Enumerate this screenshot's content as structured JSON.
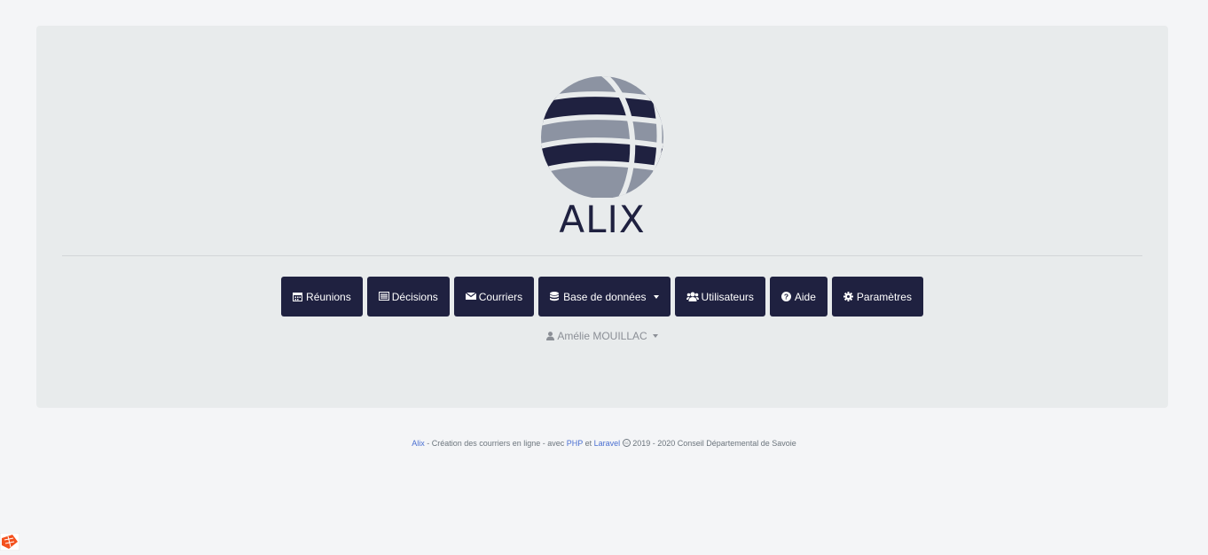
{
  "logo": {
    "text": "ALIX",
    "icon": "globe-logo-icon"
  },
  "nav": {
    "reunions": {
      "label": "Réunions",
      "icon": "calendar-icon"
    },
    "decisions": {
      "label": "Décisions",
      "icon": "list-alt-icon"
    },
    "courriers": {
      "label": "Courriers",
      "icon": "envelope-icon"
    },
    "base": {
      "label": "Base de données",
      "icon": "database-icon"
    },
    "utilisateurs": {
      "label": "Utilisateurs",
      "icon": "users-icon"
    },
    "aide": {
      "label": "Aide",
      "icon": "question-circle-icon"
    },
    "parametres": {
      "label": "Paramètres",
      "icon": "cog-icon"
    }
  },
  "user": {
    "name": "Amélie MOUILLAC",
    "icon": "user-icon"
  },
  "footer": {
    "app_link": "Alix",
    "desc": " - Création des courriers en ligne - avec ",
    "php": "PHP",
    "and": " et ",
    "laravel": "Laravel",
    "rest": " 2019 - 2020 Conseil Départemental de Savoie",
    "cc_icon": "creative-commons-icon"
  },
  "colors": {
    "primary": "#1f2140",
    "logo_grey": "#8c93a2",
    "background": "#f4f5f7",
    "panel": "#e8ebec",
    "link": "#4a6fd1"
  }
}
